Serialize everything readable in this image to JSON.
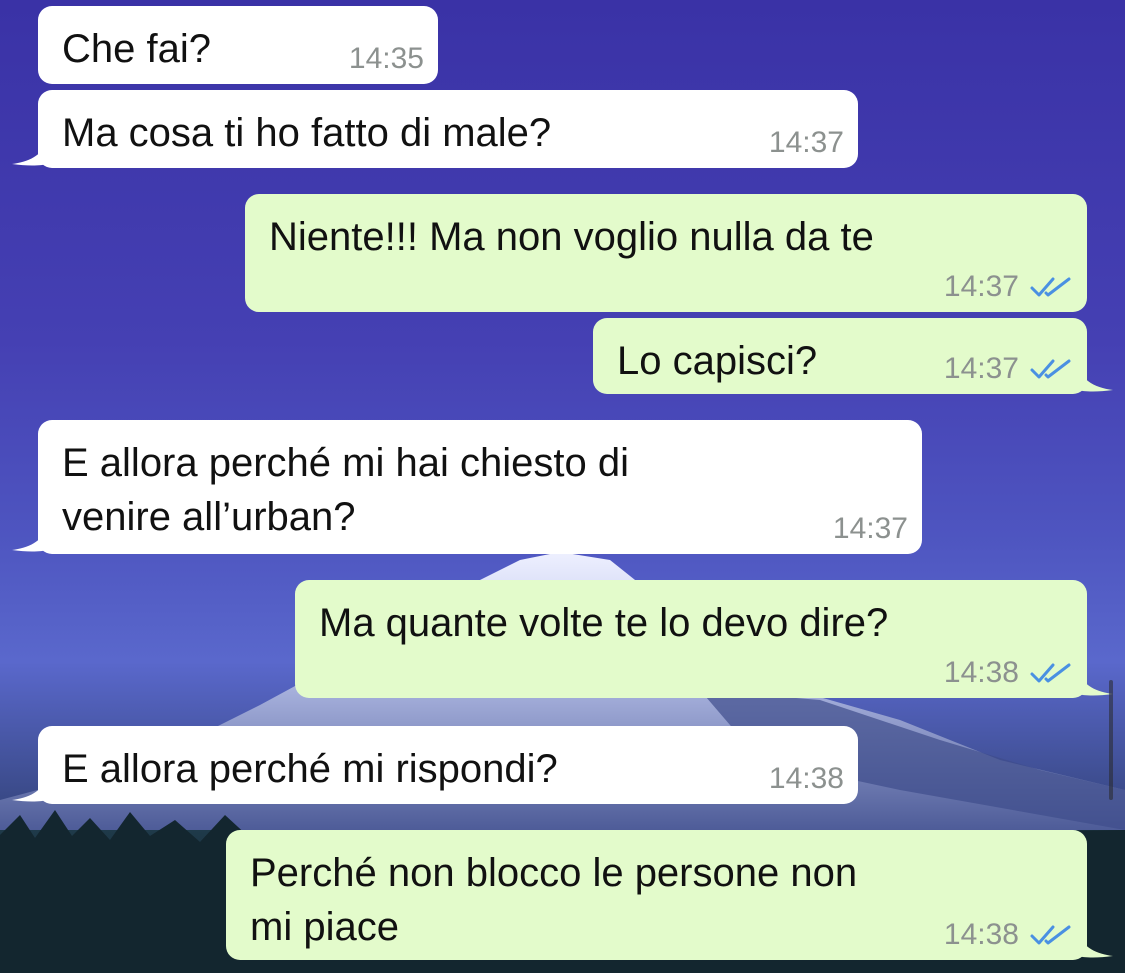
{
  "messages": [
    {
      "direction": "incoming",
      "text": "Che fai?",
      "time": "14:35"
    },
    {
      "direction": "incoming",
      "text": "Ma cosa ti ho fatto di male?",
      "time": "14:37"
    },
    {
      "direction": "outgoing",
      "text": "Niente!!! Ma non voglio nulla da te",
      "time": "14:37",
      "status": "read"
    },
    {
      "direction": "outgoing",
      "text": "Lo capisci?",
      "time": "14:37",
      "status": "read"
    },
    {
      "direction": "incoming",
      "text": "E allora perché mi hai chiesto di\nvenire all’urban?",
      "time": "14:37"
    },
    {
      "direction": "outgoing",
      "text": "Ma quante volte te lo devo dire?",
      "time": "14:38",
      "status": "read"
    },
    {
      "direction": "incoming",
      "text": "E allora perché mi rispondi?",
      "time": "14:38"
    },
    {
      "direction": "outgoing",
      "text": "Perché non blocco le persone non\nmi piace",
      "time": "14:38",
      "status": "read"
    }
  ],
  "colors": {
    "incoming_bubble": "#ffffff",
    "outgoing_bubble": "#e3fbcb",
    "read_ticks": "#4a90e2",
    "timestamp": "#8c918f"
  },
  "icons": {
    "read_receipt": "double-check-icon"
  }
}
